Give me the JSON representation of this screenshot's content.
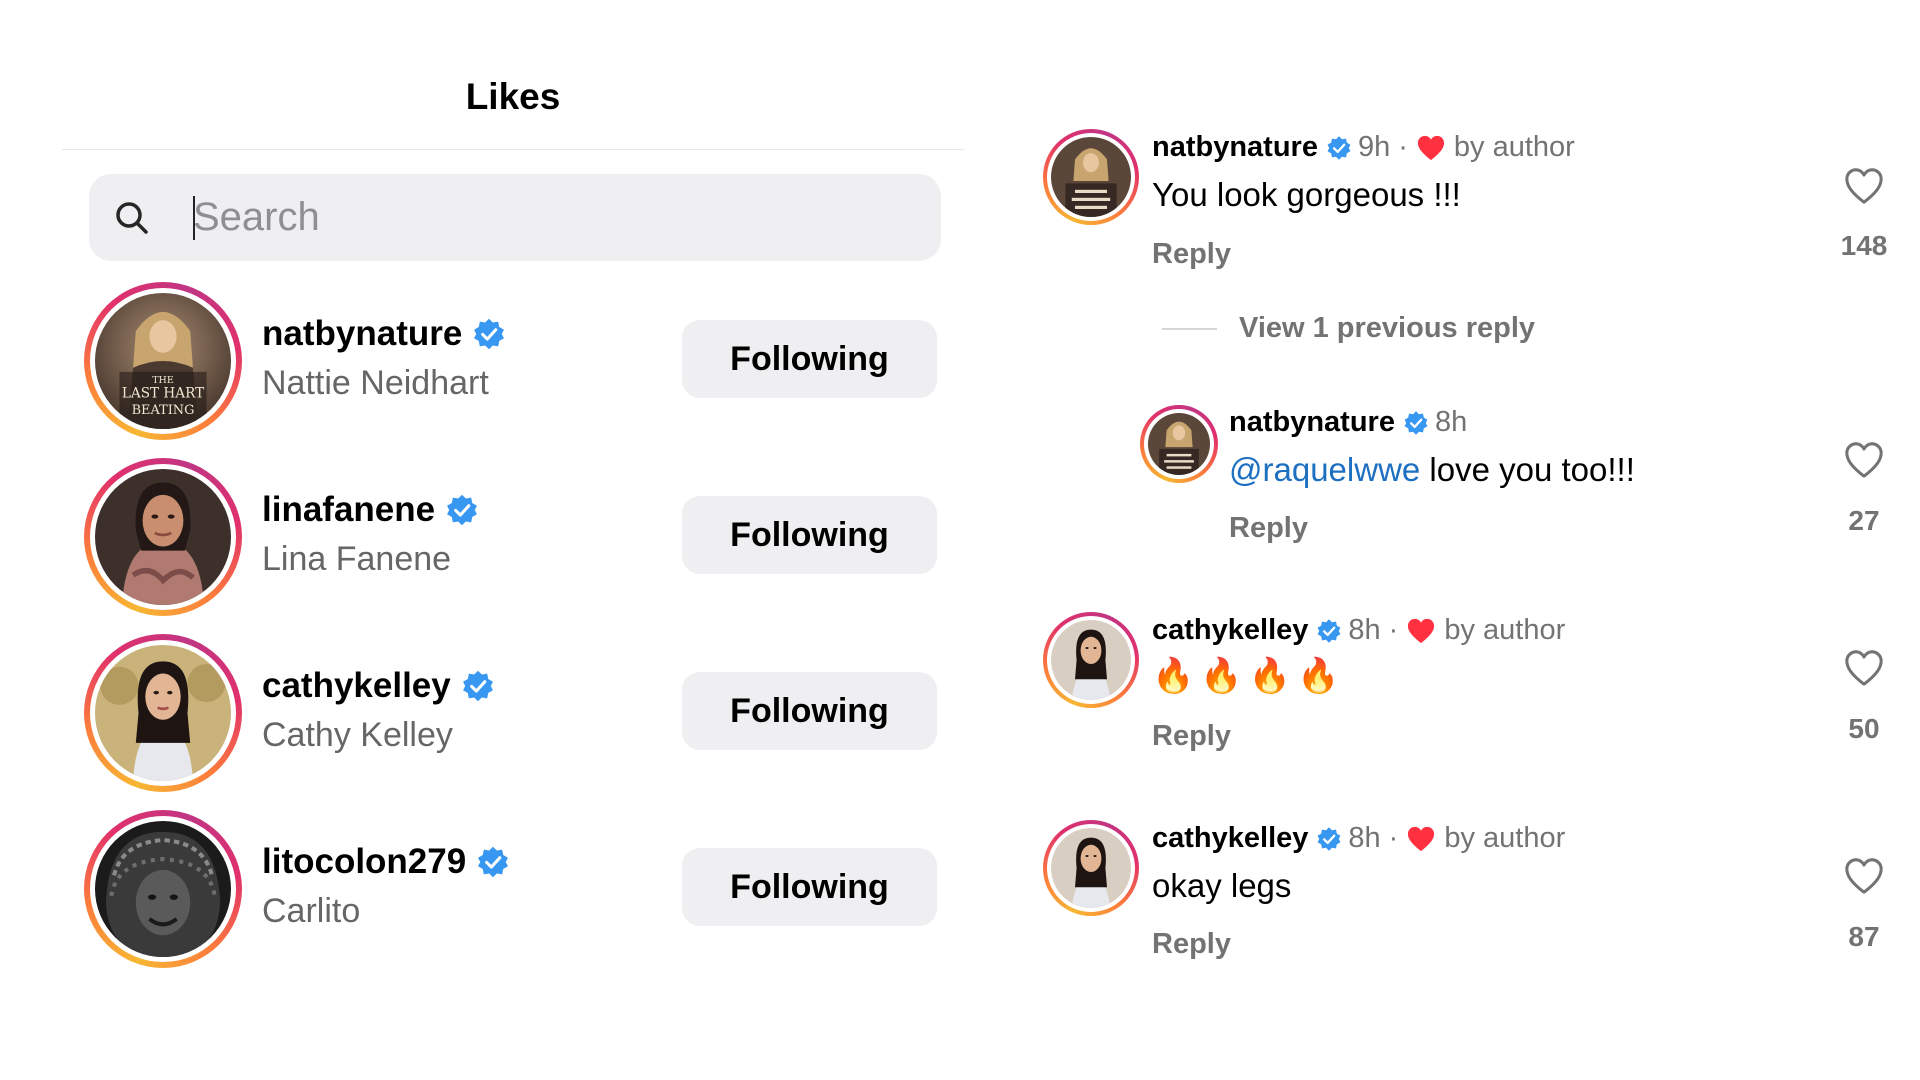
{
  "likes": {
    "title": "Likes",
    "search": {
      "placeholder": "Search",
      "value": ""
    },
    "users": [
      {
        "username": "natbynature",
        "full_name": "Nattie Neidhart",
        "button": "Following",
        "avatar_caption": "THE LAST HART BEATING"
      },
      {
        "username": "linafanene",
        "full_name": "Lina Fanene",
        "button": "Following"
      },
      {
        "username": "cathykelley",
        "full_name": "Cathy Kelley",
        "button": "Following"
      },
      {
        "username": "litocolon279",
        "full_name": "Carlito",
        "button": "Following"
      }
    ]
  },
  "comments": {
    "view_replies": "View 1 previous reply",
    "items": [
      {
        "username": "natbynature",
        "time": "9h",
        "liked_by_author": true,
        "author_label": "by author",
        "text": "You look gorgeous !!!",
        "reply": "Reply",
        "likes": "148"
      },
      {
        "username": "natbynature",
        "time": "8h",
        "liked_by_author": false,
        "mention": "@raquelwwe",
        "text": " love you too!!!",
        "reply": "Reply",
        "likes": "27"
      },
      {
        "username": "cathykelley",
        "time": "8h",
        "liked_by_author": true,
        "author_label": "by author",
        "text": "🔥🔥🔥🔥",
        "reply": "Reply",
        "likes": "50"
      },
      {
        "username": "cathykelley",
        "time": "8h",
        "liked_by_author": true,
        "author_label": "by author",
        "text": "okay legs",
        "reply": "Reply",
        "likes": "87"
      }
    ]
  },
  "colors": {
    "verified": "#3897f0",
    "heart": "#ff3040",
    "mention": "#1d6fc1",
    "button_bg": "#efeff1",
    "muted": "#737373"
  }
}
